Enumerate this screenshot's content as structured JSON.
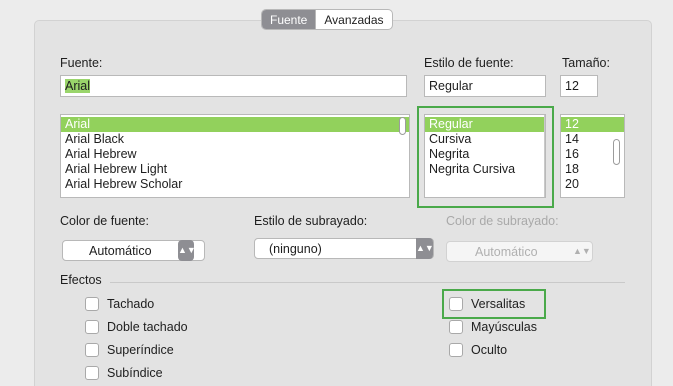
{
  "tabs": {
    "active": "Fuente",
    "other": "Avanzadas"
  },
  "font": {
    "label": "Fuente:",
    "value": "Arial",
    "list": [
      "Arial",
      "Arial Black",
      "Arial Hebrew",
      "Arial Hebrew Light",
      "Arial Hebrew Scholar"
    ],
    "selected_index": 0
  },
  "style": {
    "label": "Estilo de fuente:",
    "value": "Regular",
    "list": [
      "Regular",
      "Cursiva",
      "Negrita",
      "Negrita Cursiva"
    ],
    "selected_index": 0
  },
  "size": {
    "label": "Tamaño:",
    "value": "12",
    "list": [
      "12",
      "14",
      "16",
      "18",
      "20"
    ],
    "selected_index": 0
  },
  "font_color": {
    "label": "Color de fuente:",
    "value": "Automático"
  },
  "underline_style": {
    "label": "Estilo de subrayado:",
    "value": "(ninguno)"
  },
  "underline_color": {
    "label": "Color de subrayado:",
    "value": "Automático",
    "disabled": true
  },
  "effects": {
    "label": "Efectos",
    "left": [
      "Tachado",
      "Doble tachado",
      "Superíndice",
      "Subíndice"
    ],
    "right": [
      "Versalitas",
      "Mayúsculas",
      "Oculto"
    ],
    "checked": []
  },
  "colors": {
    "selection": "#92d15c",
    "focus": "#4aa94a",
    "tab_active": "#8e8e93"
  }
}
